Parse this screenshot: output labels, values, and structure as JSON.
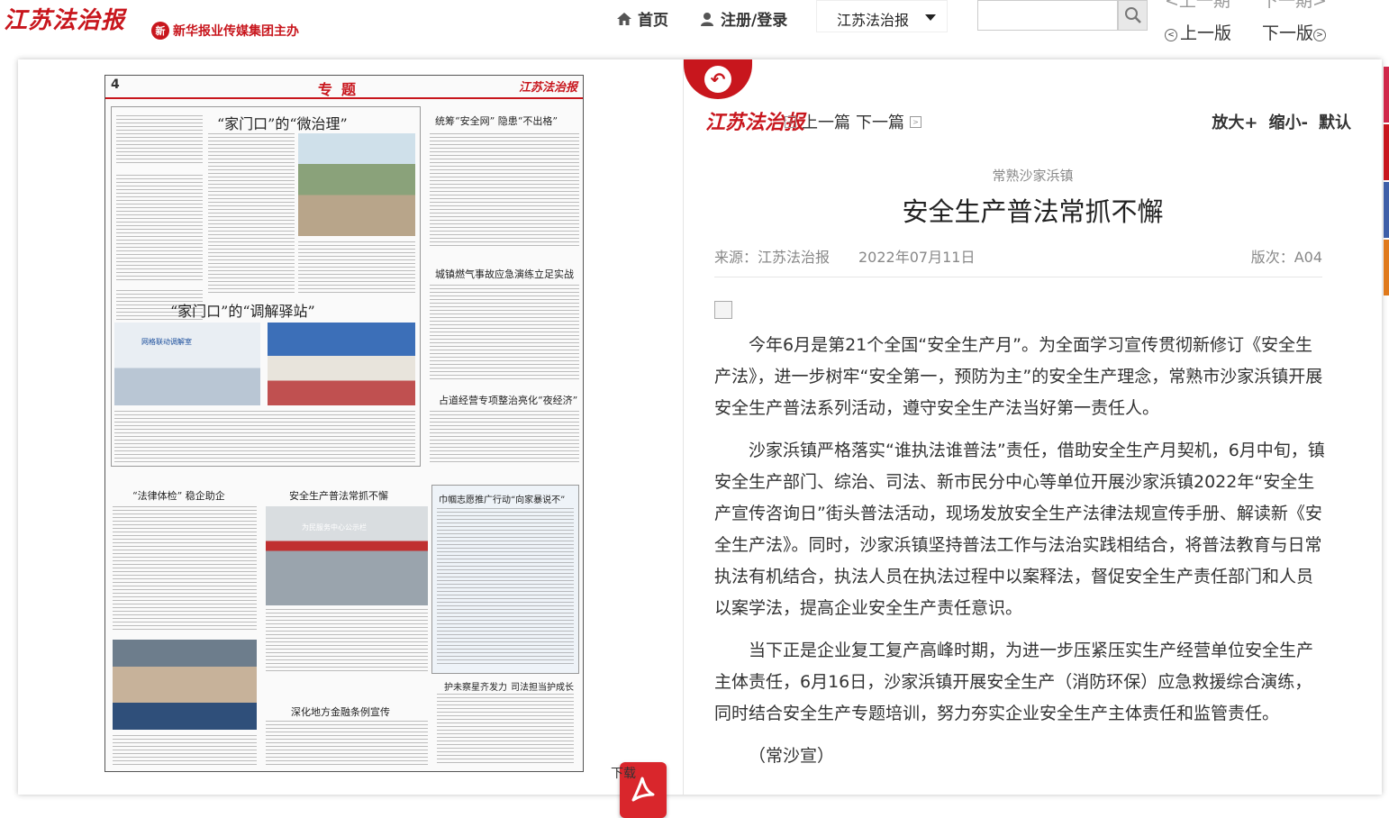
{
  "header": {
    "site_logo": "江苏法治报",
    "group_logo": "新华报业传媒集团主办",
    "group_mark": "新",
    "home": "首页",
    "login": "注册/登录",
    "paper_select": "江苏法治报",
    "search": {
      "placeholder": ""
    },
    "prev_issue": "上一期",
    "next_issue": "下一期",
    "prev_page": "上一版",
    "next_page": "下一版"
  },
  "newspaper": {
    "page_num": "4",
    "section": "专题",
    "brand": "江苏法治报",
    "stories": [
      {
        "title": "“家门口”的“微治理”"
      },
      {
        "title": "“家门口”的“调解驿站”"
      },
      {
        "title": "统筹“安全网” 隐患“不出格”"
      },
      {
        "title": "城镇燃气事故应急演练立足实战"
      },
      {
        "title": "占道经营专项整治亮化“夜经济”"
      },
      {
        "title": "“法律体检” 稳企助企"
      },
      {
        "title": "安全生产普法常抓不懈"
      },
      {
        "title": "巾帼志愿推广行动“向家暴说不”"
      },
      {
        "title": "深化地方金融条例宣传"
      },
      {
        "title": "护未察星齐发力"
      },
      {
        "title": "司法担当护成长"
      }
    ],
    "photo_banners": [
      "网格联动调解室",
      "为民服务中心公示栏"
    ]
  },
  "download": {
    "label": "下载"
  },
  "article": {
    "logo": "江苏法治报",
    "prev_article": "上一篇",
    "next_article": "下一篇",
    "zoom_in": "放大+",
    "zoom_out": "缩小-",
    "default": "默认",
    "kicker": "常熟沙家浜镇",
    "title": "安全生产普法常抓不懈",
    "source": "来源：江苏法治报",
    "date": "2022年07月11日",
    "edition": "版次：A04",
    "paragraphs": [
      "今年6月是第21个全国“安全生产月”。为全面学习宣传贯彻新修订《安全生产法》，进一步树牢“安全第一，预防为主”的安全生产理念，常熟市沙家浜镇开展安全生产普法系列活动，遵守安全生产法当好第一责任人。",
      "沙家浜镇严格落实“谁执法谁普法”责任，借助安全生产月契机，6月中旬，镇安全生产部门、综治、司法、新市民分中心等单位开展沙家浜镇2022年“安全生产宣传咨询日”街头普法活动，现场发放安全生产法律法规宣传手册、解读新《安全生产法》。同时，沙家浜镇坚持普法工作与法治实践相结合，将普法教育与日常执法有机结合，执法人员在执法过程中以案释法，督促安全生产责任部门和人员以案学法，提高企业安全生产责任意识。",
      "当下正是企业复工复产高峰时期，为进一步压紧压实生产经营单位安全生产主体责任，6月16日，沙家浜镇开展安全生产（消防环保）应急救援综合演练，同时结合安全生产专题培训，努力夯实企业安全生产主体责任和监管责任。",
      "（常沙宣）"
    ]
  },
  "colors": {
    "brand_red": "#c8161d",
    "accent_strip": [
      "#d0284a",
      "#c8161d",
      "#3e5fa8",
      "#e07a1c"
    ]
  },
  "icons": [
    "home-icon",
    "user-icon",
    "chevron-down-icon",
    "search-icon",
    "prev-circle-icon",
    "next-circle-icon",
    "back-arrow-icon",
    "pdf-icon"
  ]
}
